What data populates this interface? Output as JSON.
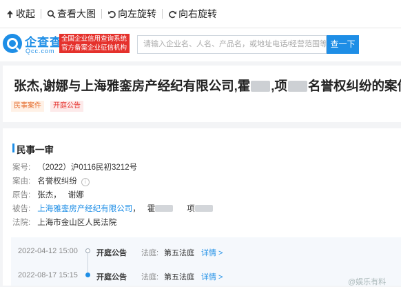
{
  "toolbar": {
    "collapse": "收起",
    "view_large": "查看大图",
    "rotate_left": "向左旋转",
    "rotate_right": "向右旋转"
  },
  "header": {
    "logo_cn": "企查查",
    "logo_en": "Qcc.com",
    "badge_line1": "全国企业信用查询系统",
    "badge_line2": "官方备案企业征信机构",
    "search_placeholder": "请输入企业名、人名、产品名，或地址电话/经营范围等",
    "search_button": "查一下"
  },
  "case": {
    "title_part1": "张杰,谢娜与上海雅銮房产经纪有限公司,霍",
    "title_part2": ",项",
    "title_part3": "名誉权纠纷的案件",
    "tags": [
      "民事案件",
      "开庭公告"
    ]
  },
  "detail": {
    "section_title": "民事一审",
    "case_no_label": "案号:",
    "case_no": "（2022）沪0116民初3212号",
    "cause_label": "案由:",
    "cause": "名誉权纠纷",
    "plaintiff_label": "原告:",
    "plaintiff_1": "张杰，",
    "plaintiff_2": "谢娜",
    "defendant_label": "被告:",
    "defendant_company": "上海雅銮房产经纪有限公司",
    "defendant_sep": "，",
    "defendant_p1": "霍",
    "defendant_p2": "项",
    "court_label": "法院:",
    "court": "上海市金山区人民法院"
  },
  "timeline": [
    {
      "date": "2022-04-12 15:00",
      "type": "开庭公告",
      "court_label": "法庭:",
      "court": "第五法庭",
      "detail": "详情 >"
    },
    {
      "date": "2022-08-17 15:15",
      "type": "开庭公告",
      "court_label": "法庭:",
      "court": "第五法庭",
      "detail": "详情 >"
    }
  ],
  "watermark": "@娱乐有料",
  "colors": {
    "accent": "#1e8ee6",
    "badge_red": "#e5312c",
    "tag_orange": "#e46d2e"
  }
}
